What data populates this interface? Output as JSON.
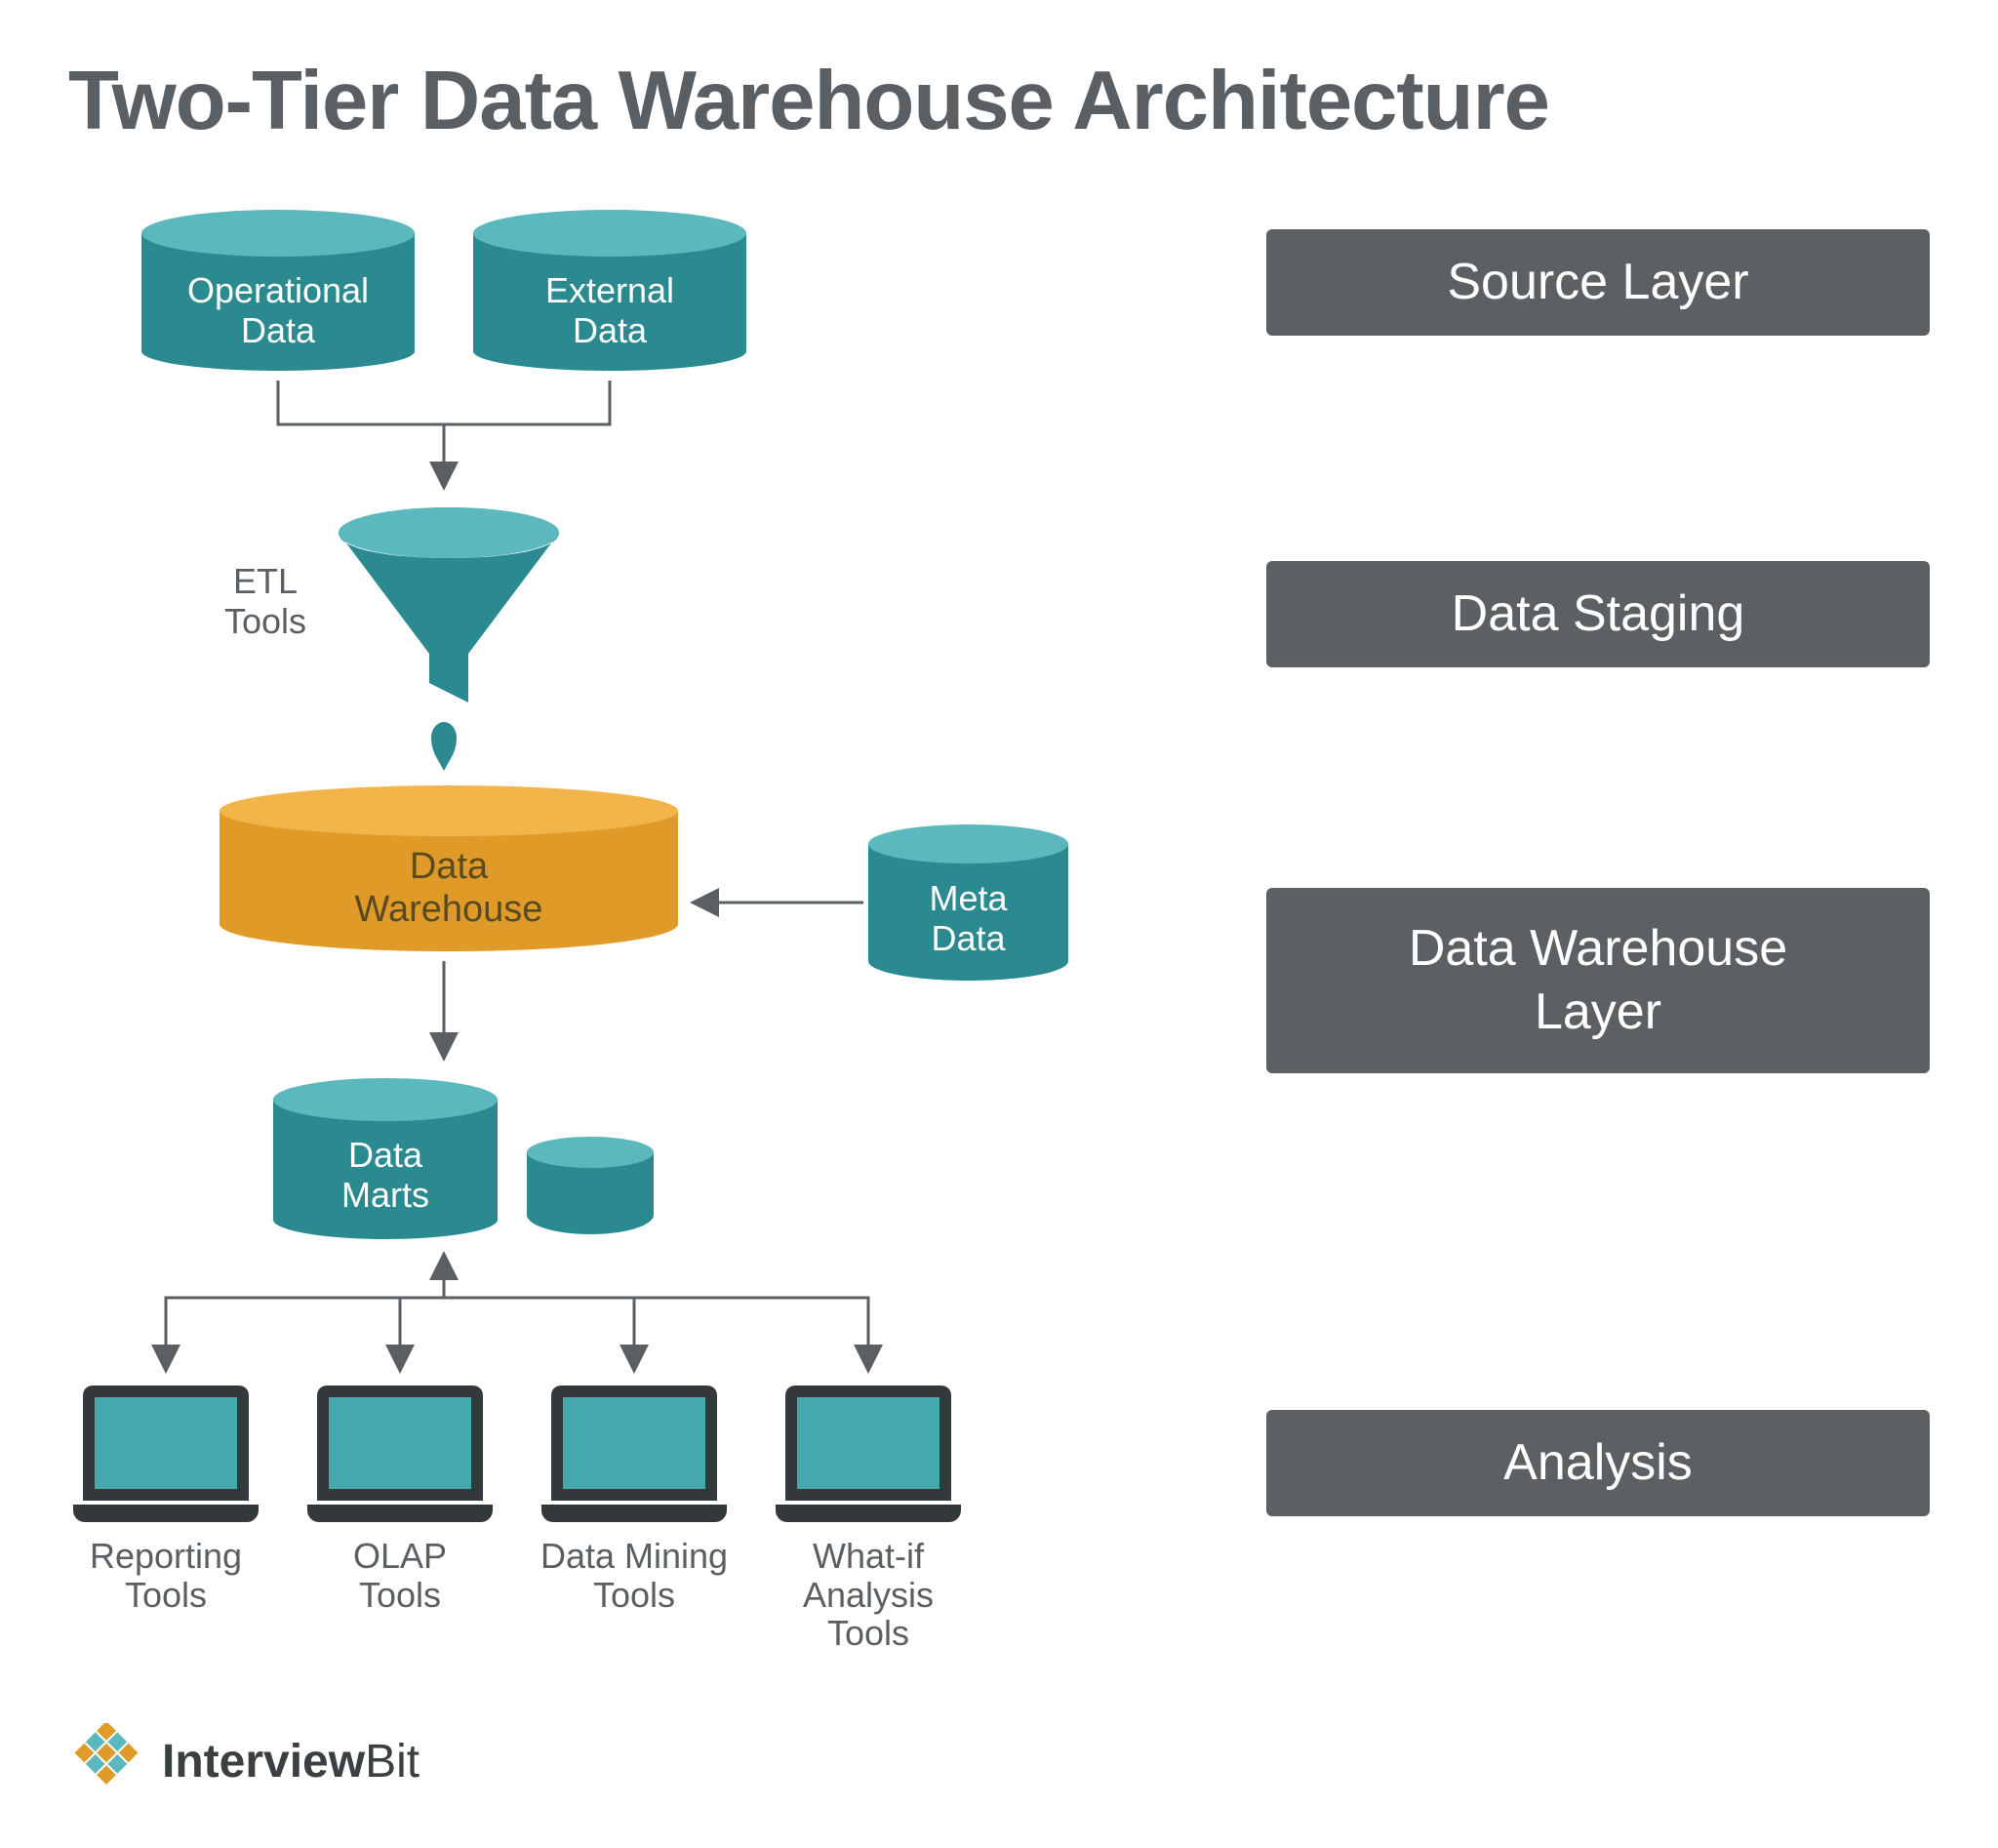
{
  "title": "Two-Tier Data Warehouse Architecture",
  "layers": {
    "source": "Source Layer",
    "staging": "Data Staging",
    "warehouse": "Data Warehouse\nLayer",
    "analysis": "Analysis"
  },
  "nodes": {
    "operational_data": "Operational\nData",
    "external_data": "External\nData",
    "etl_tools": "ETL\nTools",
    "data_warehouse": "Data\nWarehouse",
    "meta_data": "Meta\nData",
    "data_marts": "Data\nMarts"
  },
  "tools": {
    "reporting": "Reporting\nTools",
    "olap": "OLAP\nTools",
    "data_mining": "Data Mining\nTools",
    "whatif": "What-if\nAnalysis\nTools"
  },
  "brand": {
    "name_bold": "Interview",
    "name_rest": "Bit"
  },
  "colors": {
    "teal_top": "#5bb9bd",
    "teal_body": "#2b8a8f",
    "orange_top": "#f2b54a",
    "orange_body": "#e09a27",
    "gray_box": "#5c6063",
    "text_gray": "#5a5f63"
  }
}
